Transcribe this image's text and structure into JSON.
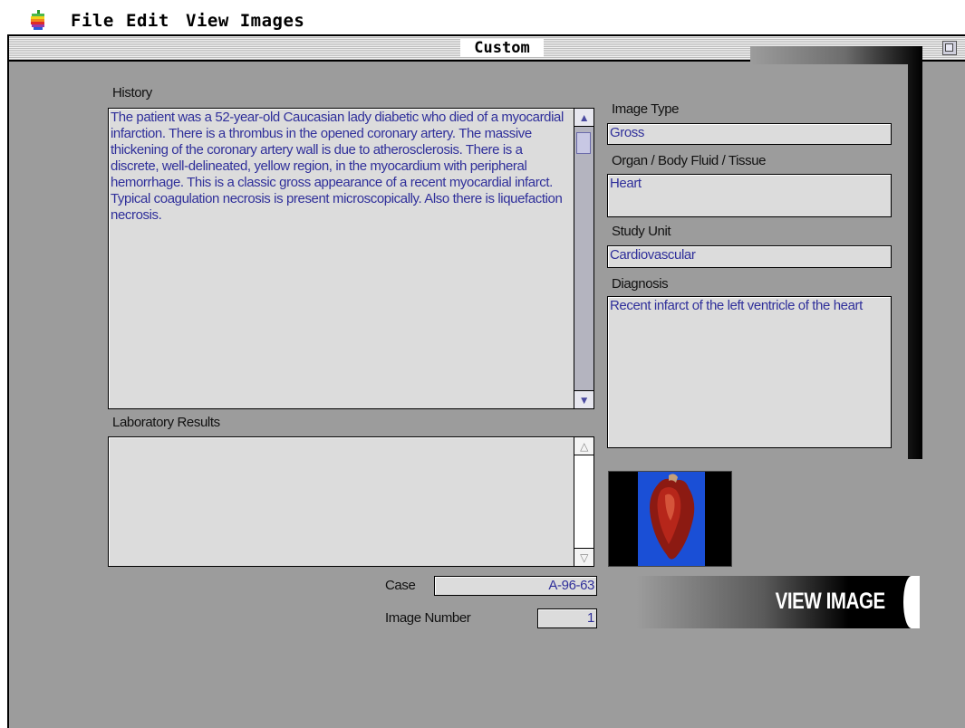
{
  "menu": {
    "file": "File",
    "edit": "Edit",
    "view_images": "View Images"
  },
  "window": {
    "title": "Custom"
  },
  "history": {
    "label": "History",
    "text": "The patient was a 52-year-old Caucasian lady diabetic who died of a myocardial infarction.  There is a thrombus in the opened coronary artery.  The massive thickening of the coronary artery wall is due to atherosclerosis.  There is a discrete, well-delineated, yellow region, in the myocardium with peripheral hemorrhage.  This is a classic gross appearance of a recent myocardial infarct.  Typical coagulation necrosis is present microscopically.  Also there is liquefaction necrosis."
  },
  "lab_results": {
    "label": "Laboratory Results",
    "text": ""
  },
  "case": {
    "label": "Case",
    "value": "A-96-63"
  },
  "image_number": {
    "label": "Image Number",
    "value": "1"
  },
  "image_type": {
    "label": "Image Type",
    "value": "Gross"
  },
  "organ": {
    "label": "Organ / Body Fluid / Tissue",
    "value": "Heart"
  },
  "study_unit": {
    "label": "Study Unit",
    "value": "Cardiovascular"
  },
  "diagnosis": {
    "label": "Diagnosis",
    "value": "Recent infarct of the left ventricle of the heart"
  },
  "view_image": {
    "label": "VIEW IMAGE"
  },
  "colors": {
    "window_bg": "#9c9c9c",
    "field_bg": "#dcdcdc",
    "field_text": "#2f2f9a",
    "thumbnail_bg": "#1a4fd6"
  },
  "icons": [
    "apple-icon",
    "zoom-box-icon",
    "scroll-up-arrow-icon",
    "scroll-down-arrow-icon"
  ]
}
